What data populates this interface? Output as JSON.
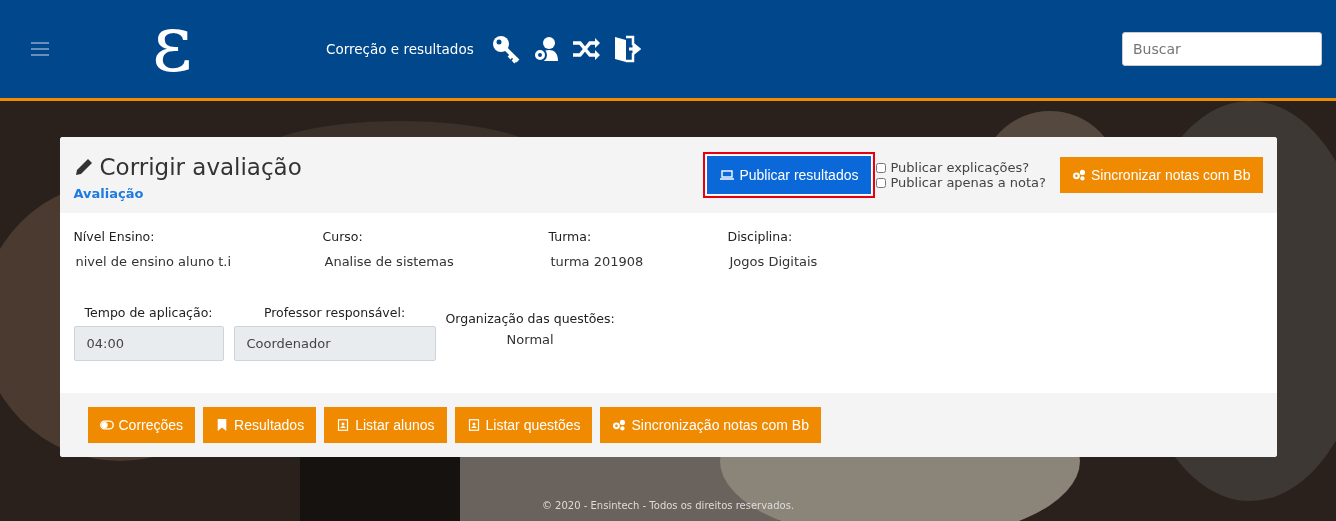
{
  "header": {
    "logo": "ε",
    "nav_title": "Correção e resultados",
    "search": {
      "placeholder": "Buscar"
    }
  },
  "card": {
    "title": "Corrigir avaliação",
    "subtitle": "Avaliação",
    "publish_button": {
      "label": "Publicar resultados",
      "selected": true
    },
    "options": [
      {
        "label": "Publicar explicações?",
        "checked": false
      },
      {
        "label": "Publicar apenas a nota?",
        "checked": false
      }
    ],
    "sync_button": "Sincronizar notas com Bb",
    "info": [
      {
        "label": "Nível Ensino:",
        "value": "nivel de ensino aluno t.i"
      },
      {
        "label": "Curso:",
        "value": "Analise de sistemas"
      },
      {
        "label": "Turma:",
        "value": "turma 201908"
      },
      {
        "label": "Disciplina:",
        "value": "Jogos Digitais"
      }
    ],
    "fields": [
      {
        "kind": "input",
        "label": "Tempo de aplicação:",
        "value": "04:00"
      },
      {
        "kind": "input",
        "label": "Professor responsável:",
        "value": "Coordenador"
      },
      {
        "kind": "text",
        "label": "Organização das questões:",
        "value": "Normal"
      }
    ],
    "actions": [
      {
        "kind": "toggle",
        "label": "Correções"
      },
      {
        "kind": "bookmark",
        "label": "Resultados"
      },
      {
        "kind": "contact",
        "label": "Listar alunos"
      },
      {
        "kind": "contact",
        "label": "Listar questões"
      },
      {
        "kind": "gears",
        "label": "Sincronização notas com Bb"
      }
    ]
  },
  "footer": "© 2020 - Ensintech - Todos os direitos reservados."
}
